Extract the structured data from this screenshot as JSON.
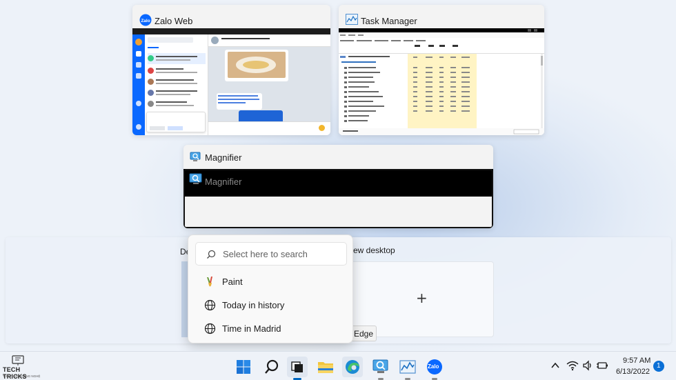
{
  "windows": {
    "zalo": {
      "title": "Zalo Web"
    },
    "task_manager": {
      "title": "Task Manager"
    },
    "magnifier": {
      "title": "Magnifier",
      "inner_title": "Magnifier"
    }
  },
  "desktops": {
    "desktop1_label": "De",
    "new_desktop_label": "ew desktop",
    "new_desktop_plus": "+"
  },
  "search_popup": {
    "placeholder": "Select here to search",
    "items": [
      {
        "label": "Paint",
        "icon": "paint-icon"
      },
      {
        "label": "Today in history",
        "icon": "globe-icon"
      },
      {
        "label": "Time in Madrid",
        "icon": "globe-icon"
      }
    ]
  },
  "tooltip": {
    "text": "Edge"
  },
  "watermark": {
    "line1": "TECH TRICKS",
    "line2": "THỦ THUẬT CÔNG NGHỆ"
  },
  "taskbar": {
    "apps": [
      "start",
      "search",
      "task-view",
      "file-explorer",
      "edge",
      "magnifier",
      "task-manager",
      "zalo"
    ],
    "zalo_label": "Zalo",
    "time": "9:57 AM",
    "date": "6/13/2022",
    "notification_count": "1"
  },
  "colors": {
    "accent": "#0067c0",
    "zalo_blue": "#0a68ff",
    "badge": "#0a6fd6"
  }
}
